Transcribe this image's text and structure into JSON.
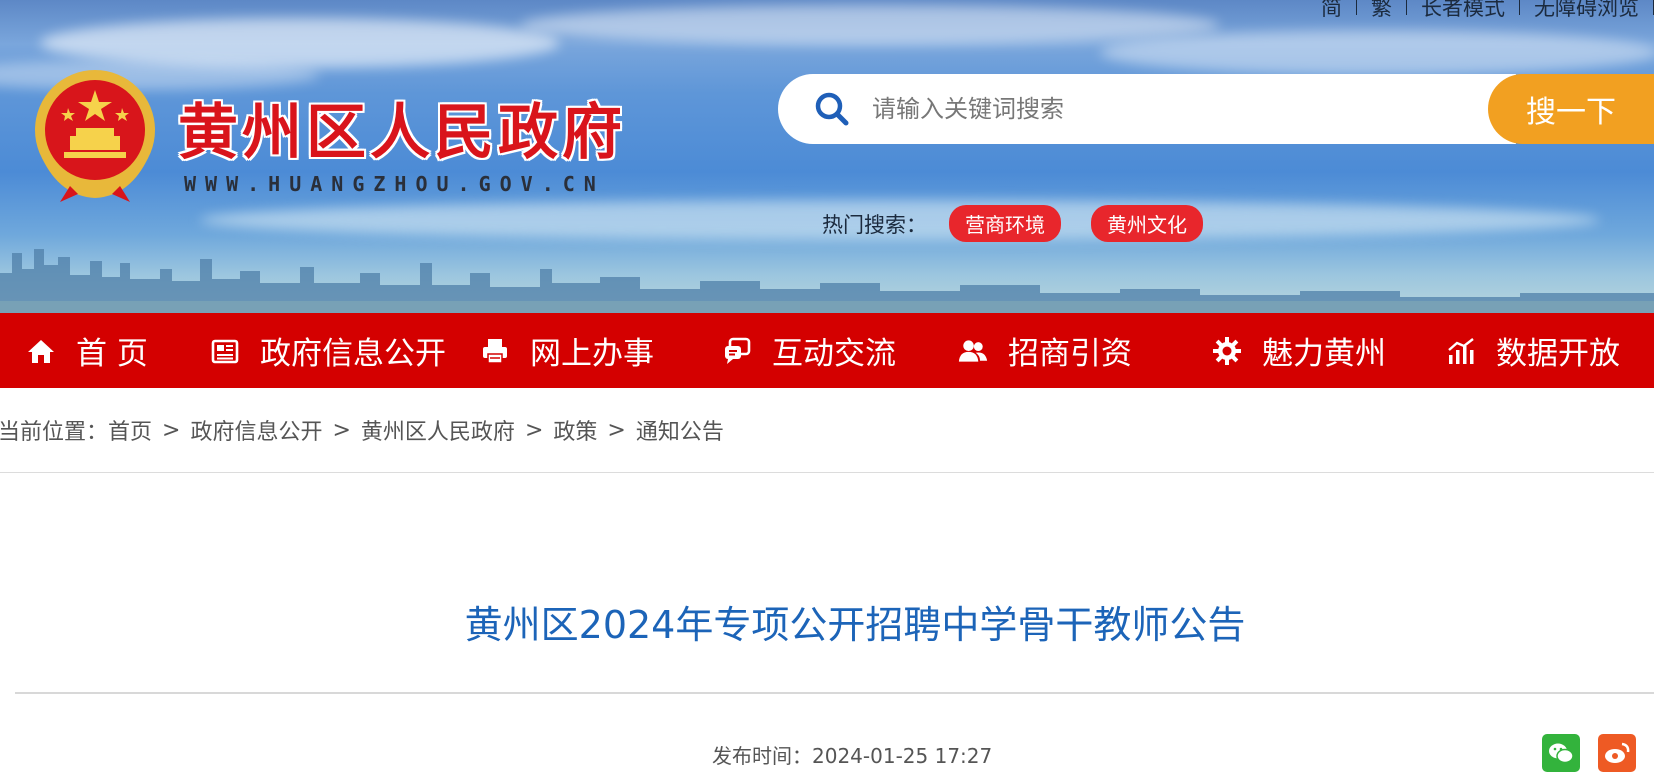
{
  "header": {
    "top_links": [
      "简",
      "繁",
      "长者模式",
      "无障碍浏览"
    ],
    "site_title": "黄州区人民政府",
    "site_url": "WWW.HUANGZHOU.GOV.CN",
    "search": {
      "placeholder": "请输入关键词搜索",
      "button": "搜一下"
    },
    "hot_search": {
      "label": "热门搜索：",
      "tags": [
        "营商环境",
        "黄州文化"
      ]
    }
  },
  "nav": {
    "items": [
      {
        "label": "首 页",
        "icon": "home-icon"
      },
      {
        "label": "政府信息公开",
        "icon": "newspaper-icon"
      },
      {
        "label": "网上办事",
        "icon": "printer-icon"
      },
      {
        "label": "互动交流",
        "icon": "chat-icon"
      },
      {
        "label": "招商引资",
        "icon": "users-icon"
      },
      {
        "label": "魅力黄州",
        "icon": "gear-icon"
      },
      {
        "label": "数据开放",
        "icon": "chart-icon"
      }
    ]
  },
  "breadcrumb": {
    "prefix": "当前位置：",
    "items": [
      "首页",
      "政府信息公开",
      "黄州区人民政府",
      "政策",
      "通知公告"
    ],
    "separator": ">"
  },
  "article": {
    "title": "黄州区2024年专项公开招聘中学骨干教师公告",
    "published_label": "发布时间：",
    "published_value": "2024-01-25 17:27"
  },
  "share": {
    "icons": [
      "wechat-icon",
      "weibo-icon"
    ]
  },
  "colors": {
    "nav_red": "#d40000",
    "search_orange": "#f2a021",
    "title_blue": "#1c64b8",
    "tag_red": "#e8262c"
  }
}
